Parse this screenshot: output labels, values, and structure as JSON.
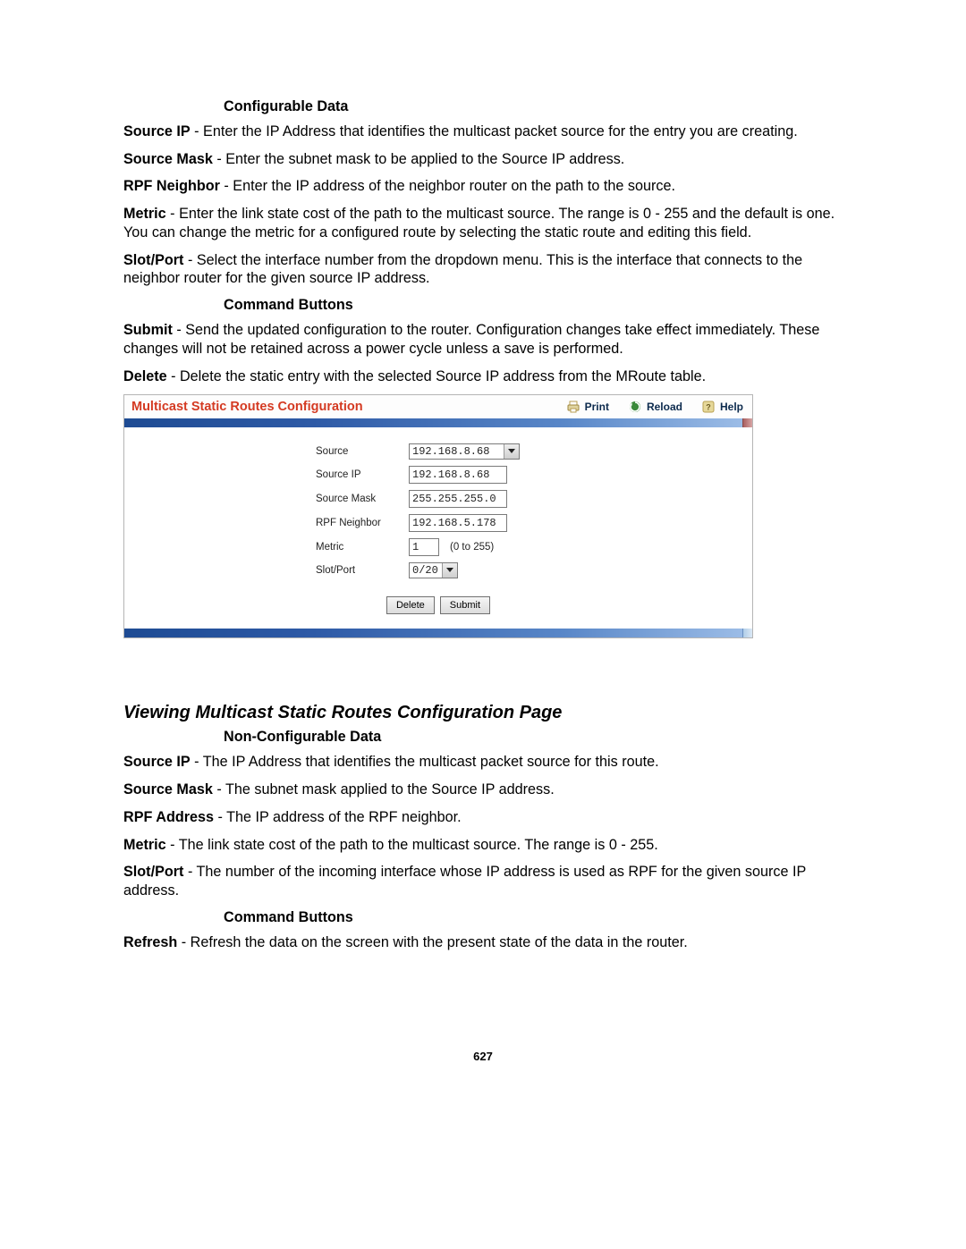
{
  "section1": {
    "heading": "Configurable Data",
    "items": [
      {
        "term": "Source IP",
        "text": " - Enter the IP Address that identifies the multicast packet source for the entry you are creating."
      },
      {
        "term": "Source Mask",
        "text": " - Enter the subnet mask to be applied to the Source IP address."
      },
      {
        "term": "RPF Neighbor",
        "text": " - Enter the IP address of the neighbor router on the path to the source."
      },
      {
        "term": "Metric",
        "text": " - Enter the link state cost of the path to the multicast source. The range is 0 - 255 and the default is one. You can change the metric for a configured route by selecting the static route and editing this field."
      },
      {
        "term": "Slot/Port",
        "text": " - Select the interface number from the dropdown menu. This is the interface that connects to the neighbor router for the given source IP address."
      }
    ]
  },
  "section2": {
    "heading": "Command Buttons",
    "items": [
      {
        "term": "Submit",
        "text": " - Send the updated configuration to the router. Configuration changes take effect immediately. These changes will not be retained across a power cycle unless a save is performed."
      },
      {
        "term": "Delete",
        "text": " - Delete the static entry with the selected Source IP address from the MRoute table."
      }
    ]
  },
  "panel": {
    "title": "Multicast Static Routes Configuration",
    "toolbar": {
      "print": "Print",
      "reload": "Reload",
      "help": "Help"
    },
    "form": {
      "source": {
        "label": "Source",
        "value": "192.168.8.68"
      },
      "source_ip": {
        "label": "Source IP",
        "value": "192.168.8.68"
      },
      "source_mask": {
        "label": "Source Mask",
        "value": "255.255.255.0"
      },
      "rpf_neighbor": {
        "label": "RPF Neighbor",
        "value": "192.168.5.178"
      },
      "metric": {
        "label": "Metric",
        "value": "1",
        "suffix": "(0 to 255)"
      },
      "slot_port": {
        "label": "Slot/Port",
        "value": "0/20"
      }
    },
    "buttons": {
      "delete": "Delete",
      "submit": "Submit"
    }
  },
  "heading2": "Viewing Multicast Static Routes Configuration Page",
  "section3": {
    "heading": "Non-Configurable Data",
    "items": [
      {
        "term": "Source IP",
        "text": " - The IP Address that identifies the multicast packet source for this route."
      },
      {
        "term": "Source Mask",
        "text": " - The subnet mask applied to the Source IP address."
      },
      {
        "term": "RPF Address",
        "text": " - The IP address of the RPF neighbor."
      },
      {
        "term": "Metric",
        "text": " - The link state cost of the path to the multicast source. The range is 0 - 255."
      },
      {
        "term": "Slot/Port",
        "text": " - The number of the incoming interface whose IP address is used as RPF for the given source IP address."
      }
    ]
  },
  "section4": {
    "heading": "Command Buttons",
    "items": [
      {
        "term": "Refresh",
        "text": " - Refresh the data on the screen with the present state of the data in the router."
      }
    ]
  },
  "page_number": "627"
}
